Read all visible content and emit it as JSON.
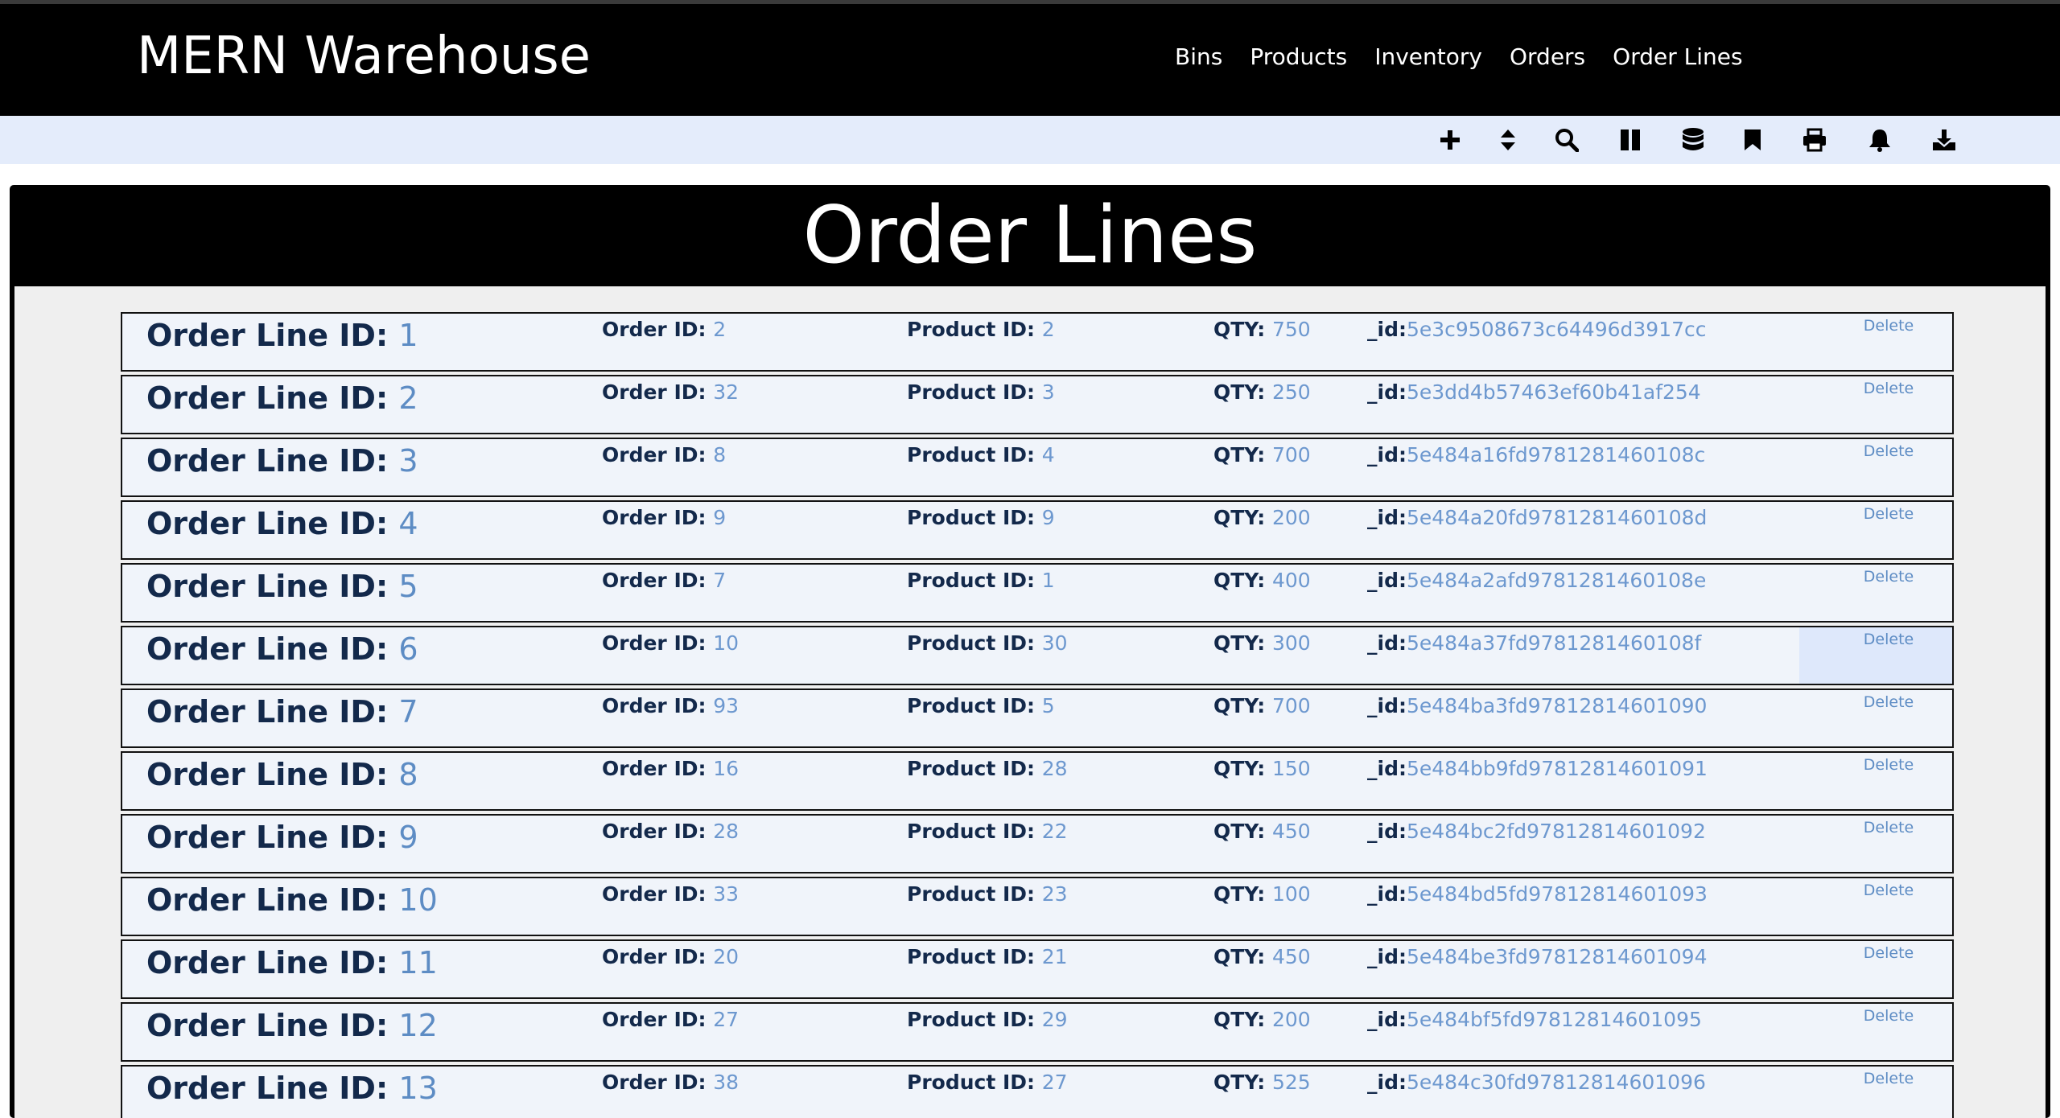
{
  "header": {
    "brand": "MERN Warehouse",
    "nav": [
      "Bins",
      "Products",
      "Inventory",
      "Orders",
      "Order Lines"
    ]
  },
  "toolbar": {
    "icons": [
      "plus-icon",
      "sort-icon",
      "search-icon",
      "pause-columns-icon",
      "database-icon",
      "bookmark-icon",
      "print-icon",
      "bell-icon",
      "download-icon"
    ]
  },
  "page": {
    "title": "Order Lines"
  },
  "labels": {
    "order_line_id": "Order Line ID: ",
    "order_id": "Order ID: ",
    "product_id": "Product ID: ",
    "qty": "QTY: ",
    "oid": "_id:",
    "delete": "Delete"
  },
  "colors": {
    "header_bg": "#000000",
    "toolbar_bg": "#e4ecfb",
    "label_text": "#13294b",
    "value_text": "#5d8cc4",
    "row_bg": "#f0f4fa"
  },
  "rows": [
    {
      "line_id": "1",
      "order_id": "2",
      "product_id": "2",
      "qty": "750",
      "oid": "5e3c9508673c64496d3917cc"
    },
    {
      "line_id": "2",
      "order_id": "32",
      "product_id": "3",
      "qty": "250",
      "oid": "5e3dd4b57463ef60b41af254"
    },
    {
      "line_id": "3",
      "order_id": "8",
      "product_id": "4",
      "qty": "700",
      "oid": "5e484a16fd9781281460108c"
    },
    {
      "line_id": "4",
      "order_id": "9",
      "product_id": "9",
      "qty": "200",
      "oid": "5e484a20fd9781281460108d"
    },
    {
      "line_id": "5",
      "order_id": "7",
      "product_id": "1",
      "qty": "400",
      "oid": "5e484a2afd9781281460108e"
    },
    {
      "line_id": "6",
      "order_id": "10",
      "product_id": "30",
      "qty": "300",
      "oid": "5e484a37fd9781281460108f"
    },
    {
      "line_id": "7",
      "order_id": "93",
      "product_id": "5",
      "qty": "700",
      "oid": "5e484ba3fd97812814601090"
    },
    {
      "line_id": "8",
      "order_id": "16",
      "product_id": "28",
      "qty": "150",
      "oid": "5e484bb9fd97812814601091"
    },
    {
      "line_id": "9",
      "order_id": "28",
      "product_id": "22",
      "qty": "450",
      "oid": "5e484bc2fd97812814601092"
    },
    {
      "line_id": "10",
      "order_id": "33",
      "product_id": "23",
      "qty": "100",
      "oid": "5e484bd5fd97812814601093"
    },
    {
      "line_id": "11",
      "order_id": "20",
      "product_id": "21",
      "qty": "450",
      "oid": "5e484be3fd97812814601094"
    },
    {
      "line_id": "12",
      "order_id": "27",
      "product_id": "29",
      "qty": "200",
      "oid": "5e484bf5fd97812814601095"
    },
    {
      "line_id": "13",
      "order_id": "38",
      "product_id": "27",
      "qty": "525",
      "oid": "5e484c30fd97812814601096"
    }
  ]
}
